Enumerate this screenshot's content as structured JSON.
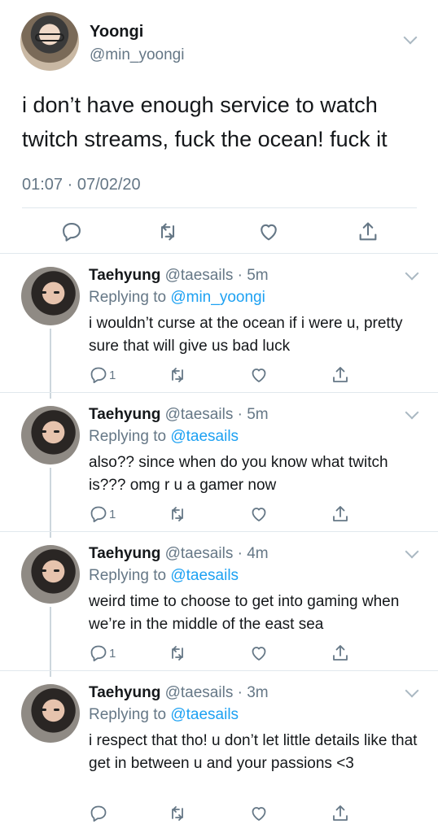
{
  "main": {
    "name": "Yoongi",
    "handle": "@min_yoongi",
    "text": "i don’t have enough service to watch twitch streams, fuck the ocean! fuck it",
    "timestamp": "01:07 · 07/02/20",
    "icons": [
      "reply-icon",
      "retweet-icon",
      "like-icon",
      "share-icon"
    ]
  },
  "replies": [
    {
      "name": "Taehyung",
      "meta": "@taesails · 5m",
      "replying_label": "Replying to",
      "replying_to": "@min_yoongi",
      "text": "i wouldn’t curse at the ocean if i were u, pretty sure that will give us bad luck",
      "reply_count": "1"
    },
    {
      "name": "Taehyung",
      "meta": "@taesails · 5m",
      "replying_label": "Replying to",
      "replying_to": "@taesails",
      "text": "also?? since when do you know what twitch is??? omg r u a gamer now",
      "reply_count": "1"
    },
    {
      "name": "Taehyung",
      "meta": "@taesails · 4m",
      "replying_label": "Replying to",
      "replying_to": "@taesails",
      "text": "weird time to choose to get into gaming when we’re in the middle of the east sea",
      "reply_count": "1"
    },
    {
      "name": "Taehyung",
      "meta": "@taesails · 3m",
      "replying_label": "Replying to",
      "replying_to": "@taesails",
      "text": "i respect that tho! u don’t let little details like that get in between u and your passions <3",
      "reply_count": ""
    }
  ],
  "colors": {
    "text": "#14171a",
    "muted": "#657786",
    "link": "#1da1f2",
    "divider": "#e1e8ed"
  }
}
